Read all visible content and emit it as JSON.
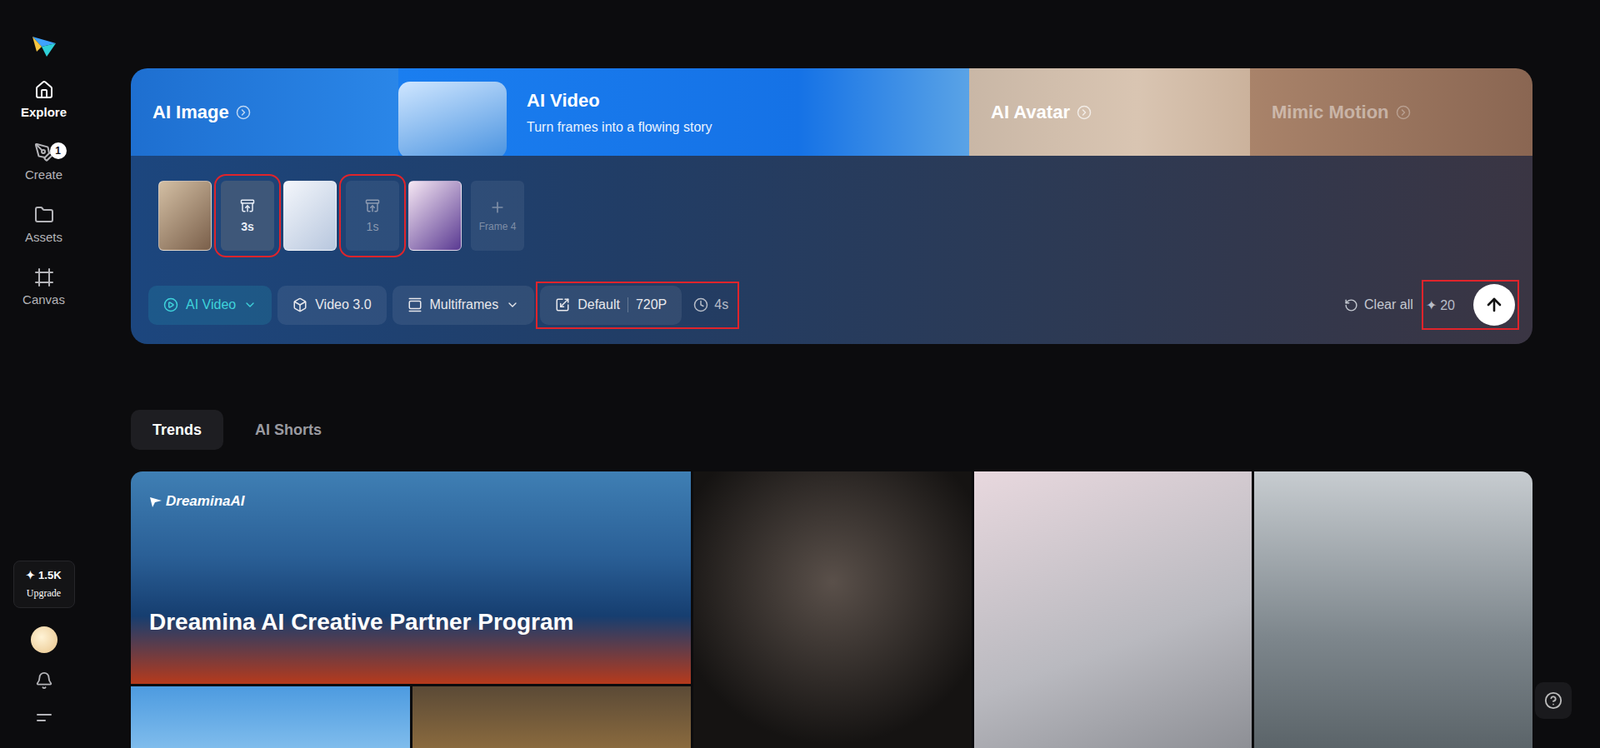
{
  "sidebar": {
    "items": [
      {
        "label": "Explore",
        "selected": true,
        "badge": ""
      },
      {
        "label": "Create",
        "selected": false,
        "badge": "1"
      },
      {
        "label": "Assets",
        "selected": false,
        "badge": ""
      },
      {
        "label": "Canvas",
        "selected": false,
        "badge": ""
      }
    ],
    "credits": {
      "icon": "✦",
      "amount": "1.5K",
      "label": "Upgrade"
    }
  },
  "banner": [
    {
      "label": "AI Image",
      "subtitle": "",
      "selected": false,
      "disabled": false,
      "chevron": true
    },
    {
      "label": "AI Video",
      "subtitle": "Turn frames into a flowing story",
      "selected": true,
      "disabled": false,
      "chevron": false
    },
    {
      "label": "AI Avatar",
      "subtitle": "",
      "selected": false,
      "disabled": false,
      "chevron": true
    },
    {
      "label": "Mimic Motion",
      "subtitle": "",
      "selected": false,
      "disabled": true,
      "chevron": true
    }
  ],
  "frames": [
    {
      "kind": "image",
      "label": "",
      "selected": false,
      "highlighted": false
    },
    {
      "kind": "transition",
      "label": "3s",
      "selected": true,
      "highlighted": true
    },
    {
      "kind": "image",
      "label": "",
      "selected": false,
      "highlighted": false
    },
    {
      "kind": "transition",
      "label": "1s",
      "selected": false,
      "highlighted": true
    },
    {
      "kind": "image",
      "label": "",
      "selected": false,
      "highlighted": false
    },
    {
      "kind": "add",
      "label": "Frame 4",
      "selected": false,
      "highlighted": false
    }
  ],
  "toolbar": {
    "mode": "AI Video",
    "model": "Video 3.0",
    "frames_mode": "Multiframes",
    "ratio": "Default",
    "resolution": "720P",
    "duration": "4s",
    "settings_highlighted": true,
    "clear": "Clear all",
    "cost_icon": "✦",
    "cost": "20",
    "submit_highlighted": true
  },
  "tabs": [
    {
      "label": "Trends",
      "selected": true
    },
    {
      "label": "AI Shorts",
      "selected": false
    }
  ],
  "gallery": {
    "featured": {
      "logo": "DreaminaAI",
      "title": "Dreamina AI Creative Partner Program"
    },
    "cards": 5
  }
}
